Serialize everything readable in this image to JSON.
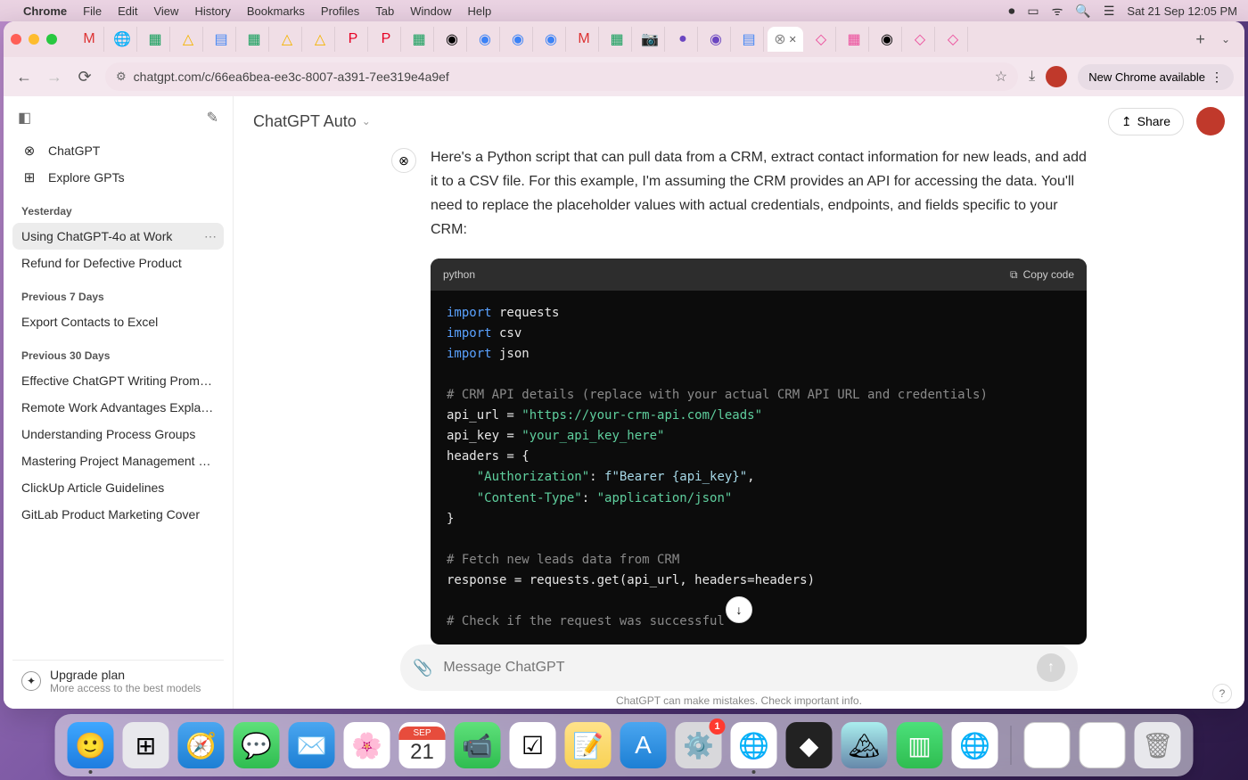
{
  "menubar": {
    "app": "Chrome",
    "items": [
      "File",
      "Edit",
      "View",
      "History",
      "Bookmarks",
      "Profiles",
      "Tab",
      "Window",
      "Help"
    ],
    "clock": "Sat 21 Sep  12:05 PM"
  },
  "chrome": {
    "url": "chatgpt.com/c/66ea6bea-ee3c-8007-a391-7ee319e4a9ef",
    "update_chip": "New Chrome available",
    "tab_favicons": [
      "M",
      "🌐",
      "▦",
      "△",
      "▤",
      "▦",
      "△",
      "△",
      "P",
      "P",
      "▦",
      "◉",
      "◉",
      "◉",
      "◉",
      "M",
      "▦",
      "📷",
      "●",
      "◉",
      "▤"
    ]
  },
  "sidebar": {
    "nav_chatgpt": "ChatGPT",
    "nav_explore": "Explore GPTs",
    "sections": [
      {
        "label": "Yesterday",
        "items": [
          "Using ChatGPT-4o at Work",
          "Refund for Defective Product"
        ]
      },
      {
        "label": "Previous 7 Days",
        "items": [
          "Export Contacts to Excel"
        ]
      },
      {
        "label": "Previous 30 Days",
        "items": [
          "Effective ChatGPT Writing Prompts",
          "Remote Work Advantages Explained",
          "Understanding Process Groups",
          "Mastering Project Management Goals",
          "ClickUp Article Guidelines",
          "GitLab Product Marketing Cover"
        ]
      }
    ],
    "active_item": "Using ChatGPT-4o at Work",
    "upgrade_title": "Upgrade plan",
    "upgrade_sub": "More access to the best models"
  },
  "header": {
    "model": "ChatGPT Auto",
    "share": "Share"
  },
  "message": {
    "text": "Here's a Python script that can pull data from a CRM, extract contact information for new leads, and add it to a CSV file. For this example, I'm assuming the CRM provides an API for accessing the data. You'll need to replace the placeholder values with actual credentials, endpoints, and fields specific to your CRM:"
  },
  "code": {
    "lang": "python",
    "copy_label": "Copy code",
    "lines_html": "<span class=\"kw\">import</span> requests\n<span class=\"kw\">import</span> csv\n<span class=\"kw\">import</span> json\n\n<span class=\"cmt\"># CRM API details (replace with your actual CRM API URL and credentials)</span>\napi_url = <span class=\"str\">\"https://your-crm-api.com/leads\"</span>\napi_key = <span class=\"str\">\"your_api_key_here\"</span>\nheaders = {\n    <span class=\"key\">\"Authorization\"</span>: <span class=\"fstr\">f\"Bearer {api_key}\"</span>,\n    <span class=\"key\">\"Content-Type\"</span>: <span class=\"str\">\"application/json\"</span>\n}\n\n<span class=\"cmt\"># Fetch new leads data from CRM</span>\nresponse = requests.get(api_url, headers=headers)\n\n<span class=\"cmt\"># Check if the request was successful</span>"
  },
  "composer": {
    "placeholder": "Message ChatGPT"
  },
  "footer": "ChatGPT can make mistakes. Check important info.",
  "dock": {
    "cal_month": "SEP",
    "cal_day": "21",
    "settings_badge": "1"
  }
}
